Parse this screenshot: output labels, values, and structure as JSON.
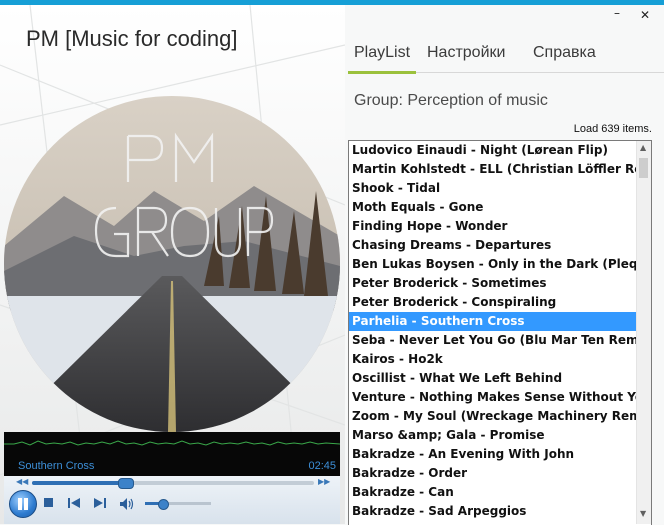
{
  "app": {
    "title": "PM [Music for coding]"
  },
  "window": {
    "minimize": "–",
    "close": "✕"
  },
  "tabs": [
    {
      "label": "PlayList",
      "active": true
    },
    {
      "label": "Настройки",
      "active": false
    },
    {
      "label": "Справка",
      "active": false
    }
  ],
  "group": {
    "label": "Group: Perception of music"
  },
  "status": {
    "text": "Load 639 items."
  },
  "cover": {
    "line1": "PM",
    "line2": "GROUP"
  },
  "player": {
    "track": "Southern Cross",
    "time": "02:45",
    "seek_fraction": 0.33,
    "volume_fraction": 0.28,
    "icons": {
      "pause": "pause-icon",
      "stop": "stop-icon",
      "prev": "previous-track-icon",
      "next": "next-track-icon",
      "volume": "speaker-icon",
      "seek_back": "rewind-icon",
      "seek_forward": "fast-forward-icon"
    },
    "seek_back_glyph": "◀◀",
    "seek_forward_glyph": "▶▶"
  },
  "playlist": {
    "selected_index": 9,
    "items": [
      "Ludovico Einaudi - Night (Lørean Flip)",
      "Martin Kohlstedt - ELL (Christian Löffler Remix)",
      "Shook - Tidal",
      "Moth Equals - Gone",
      "Finding Hope - Wonder",
      "Chasing Dreams - Departures",
      "Ben Lukas Boysen - Only in the Dark (Pleq Remix)",
      "Peter Broderick - Sometimes",
      "Peter Broderick - Conspiraling",
      "Parhelia - Southern Cross",
      "Seba  - Never Let You Go (Blu Mar Ten Remix)",
      "Kairos - Ho2k",
      "Oscillist - What We Left Behind",
      "Venture - Nothing Makes Sense Without You",
      "Zoom - My Soul (Wreckage Machinery Remix)",
      "Marso &amp; Gala - Promise",
      "Bakradze - An Evening With John",
      "Bakradze - Order",
      "Bakradze - Can",
      "Bakradze - Sad Arpeggios"
    ]
  },
  "scrollbar": {
    "up": "▲",
    "down": "▼"
  },
  "colors": {
    "accent": "#169fd6",
    "tab_underline": "#9bc13c",
    "selection": "#3399ff"
  }
}
